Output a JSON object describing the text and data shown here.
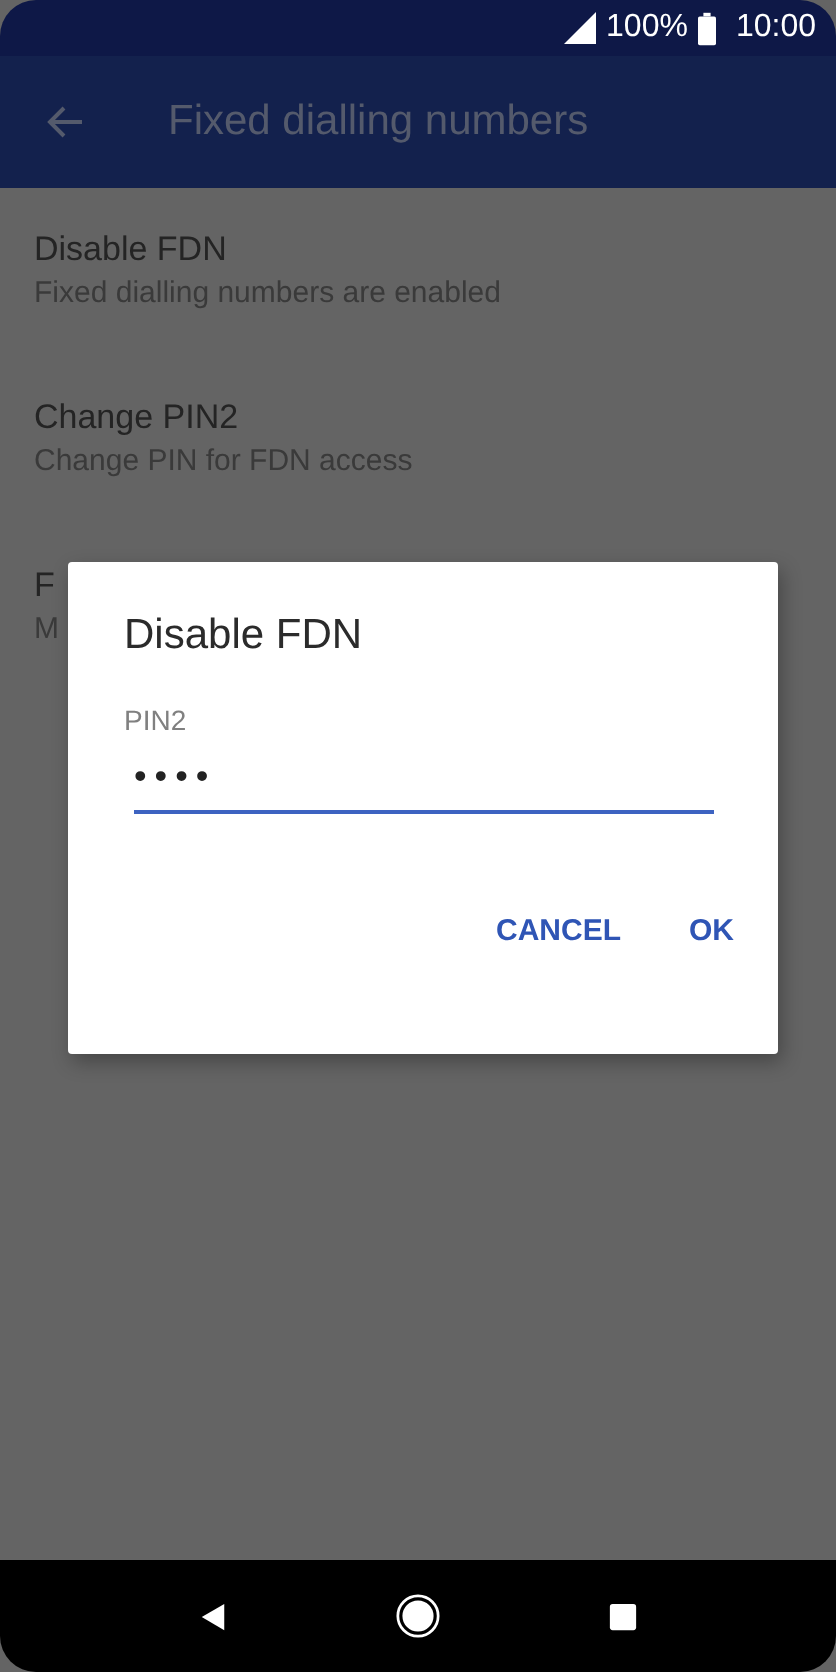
{
  "status_bar": {
    "battery": "100%",
    "time": "10:00"
  },
  "app_bar": {
    "title": "Fixed dialling numbers"
  },
  "settings": [
    {
      "title": "Disable FDN",
      "subtitle": "Fixed dialling numbers are enabled"
    },
    {
      "title": "Change PIN2",
      "subtitle": "Change PIN for FDN access"
    },
    {
      "title": "F",
      "subtitle": "M"
    }
  ],
  "dialog": {
    "title": "Disable FDN",
    "field": {
      "label": "PIN2",
      "value": "••••"
    },
    "buttons": [
      "CANCEL",
      "OK"
    ]
  }
}
